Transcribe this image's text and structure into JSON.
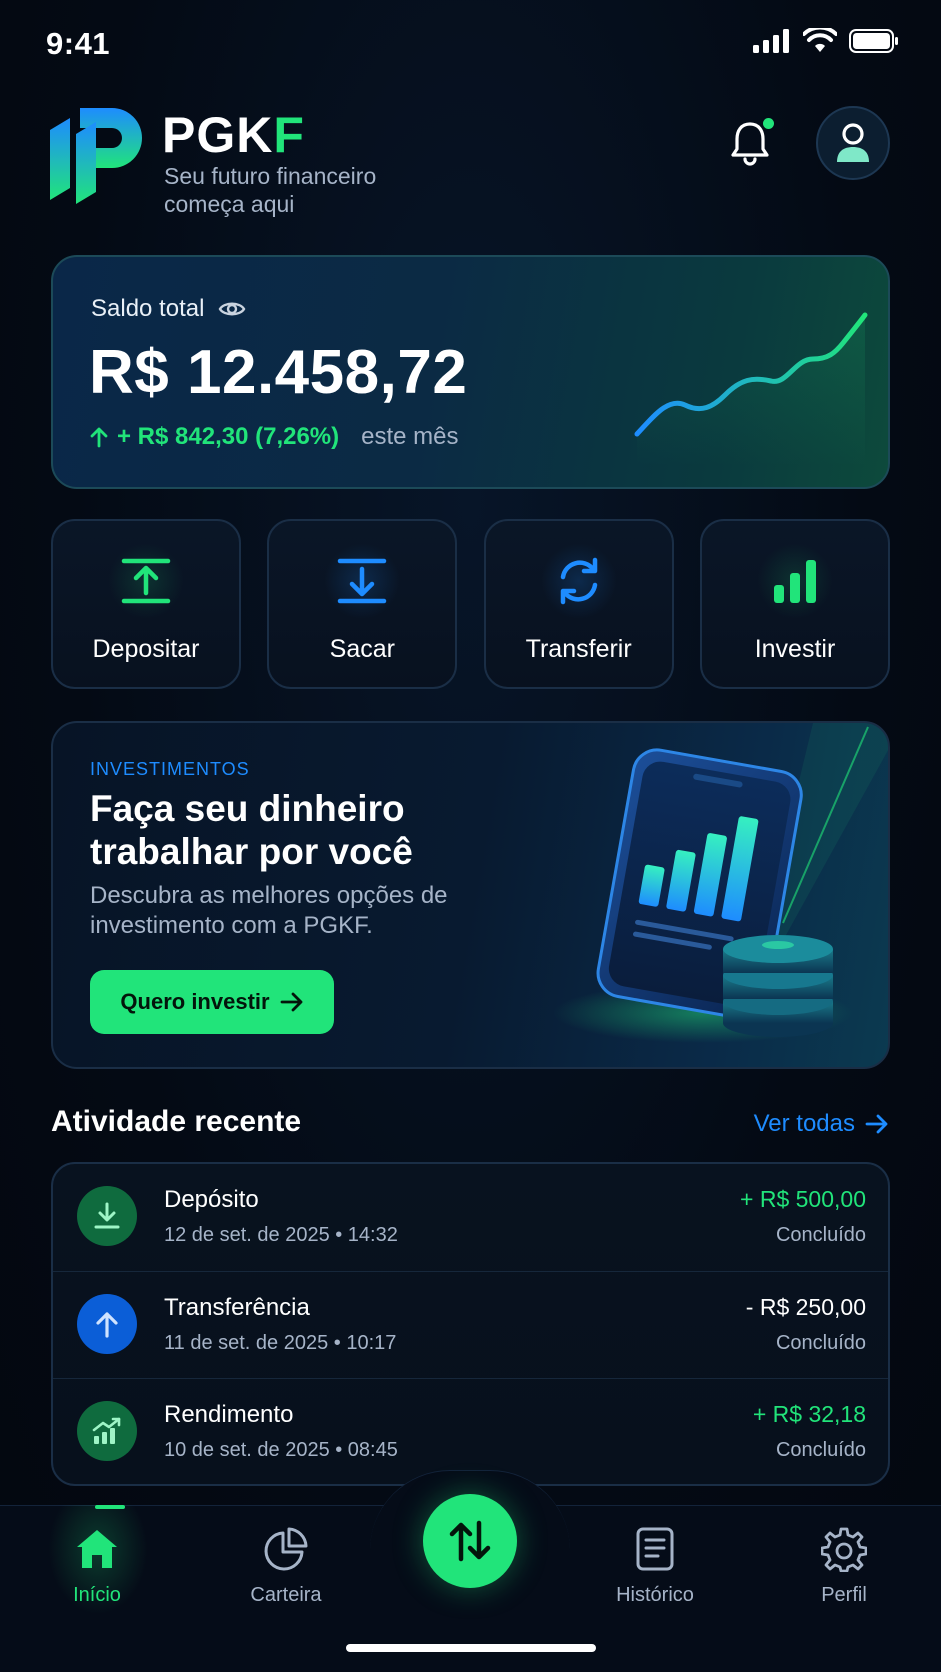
{
  "status_bar": {
    "time": "9:41"
  },
  "header": {
    "brand_prefix": "PGK",
    "brand_suffix": "F",
    "tagline": "Seu futuro financeiro começa aqui"
  },
  "balance": {
    "label": "Saldo total",
    "value": "R$ 12.458,72",
    "change": "+ R$ 842,30 (7,26%)",
    "period": "este mês"
  },
  "actions": [
    {
      "label": "Depositar",
      "icon": "deposit-icon"
    },
    {
      "label": "Sacar",
      "icon": "withdraw-icon"
    },
    {
      "label": "Transferir",
      "icon": "transfer-icon"
    },
    {
      "label": "Investir",
      "icon": "invest-bars-icon"
    }
  ],
  "promo": {
    "eyebrow": "INVESTIMENTOS",
    "title": "Faça seu dinheiro trabalhar por você",
    "description": "Descubra as melhores opções de investimento com a PGKF.",
    "button": "Quero investir"
  },
  "activity": {
    "title": "Atividade recente",
    "see_all": "Ver todas",
    "items": [
      {
        "title": "Depósito",
        "date": "12 de set. de 2025 • 14:32",
        "amount": "+ R$ 500,00",
        "status": "Concluído",
        "icon": "download-icon"
      },
      {
        "title": "Transferência",
        "date": "11 de set. de 2025 • 10:17",
        "amount": "- R$ 250,00",
        "status": "Concluído",
        "icon": "arrow-up-icon"
      },
      {
        "title": "Rendimento",
        "date": "10 de set. de 2025 • 08:45",
        "amount": "+ R$ 32,18",
        "status": "Concluído",
        "icon": "growth-chart-icon"
      }
    ]
  },
  "nav": {
    "items": [
      {
        "label": "Início",
        "icon": "home-icon",
        "active": true
      },
      {
        "label": "Carteira",
        "icon": "pie-chart-icon"
      },
      {
        "label": "Histórico",
        "icon": "document-icon"
      },
      {
        "label": "Perfil",
        "icon": "gear-icon"
      }
    ],
    "fab_icon": "swap-arrows-icon"
  },
  "colors": {
    "accent_green": "#21e47a",
    "accent_blue": "#1e8cff",
    "background": "#040a14",
    "muted_text": "#a6b4c8"
  }
}
